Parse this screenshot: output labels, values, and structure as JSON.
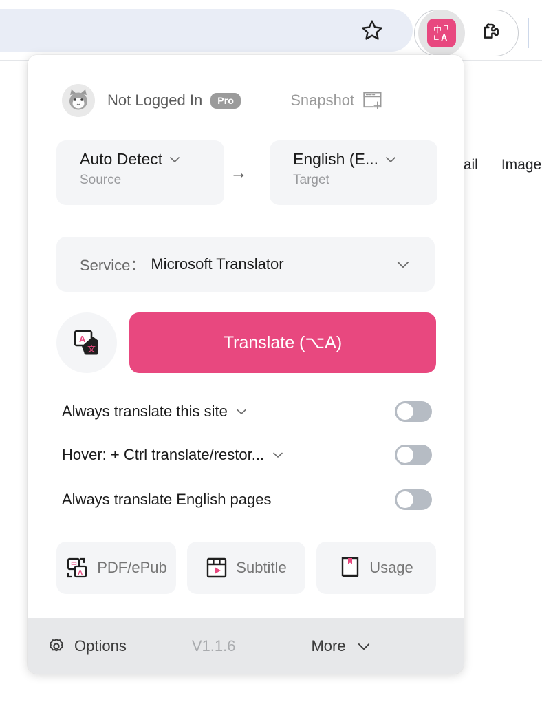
{
  "browser": {
    "star_icon": "bookmark-star-icon",
    "extension_icon": "immersive-translate-extension-icon",
    "puzzle_icon": "extensions-puzzle-icon"
  },
  "page_behind": {
    "links": [
      "Gmail",
      "Images"
    ]
  },
  "popup": {
    "account": {
      "avatar": "user-avatar",
      "name": "Not Logged In",
      "badge": "Pro",
      "snapshot_label": "Snapshot",
      "snapshot_icon": "snapshot-add-icon"
    },
    "language": {
      "source": {
        "value": "Auto Detect",
        "sublabel": "Source",
        "chevron": "chevron-down-icon"
      },
      "arrow": "→",
      "target": {
        "value": "English (E...",
        "sublabel": "Target",
        "chevron": "chevron-down-icon"
      }
    },
    "service": {
      "label": "Service：",
      "value": "Microsoft Translator",
      "chevron": "chevron-down-icon"
    },
    "translate": {
      "icon": "bilingual-translate-icon",
      "button_label": "Translate (⌥A)"
    },
    "toggles": [
      {
        "label": "Always translate this site",
        "has_chevron": true,
        "state": "off"
      },
      {
        "label": "Hover:  + Ctrl translate/restor...",
        "has_chevron": true,
        "state": "off"
      },
      {
        "label": "Always translate English pages",
        "has_chevron": false,
        "state": "off"
      }
    ],
    "features": [
      {
        "label": "PDF/ePub",
        "icon": "pdf-epub-icon"
      },
      {
        "label": "Subtitle",
        "icon": "subtitle-play-icon"
      },
      {
        "label": "Usage",
        "icon": "usage-book-icon"
      }
    ],
    "footer": {
      "options_label": "Options",
      "options_icon": "gear-icon",
      "version": "V1.1.6",
      "more_label": "More",
      "more_chevron": "chevron-down-icon"
    }
  },
  "colors": {
    "accent_pink": "#e8487f",
    "panel_gray": "#f4f5f7",
    "footer_gray": "#e7e8ea",
    "toggle_off": "#b6bcc4",
    "omnibox": "#e9edf6"
  }
}
